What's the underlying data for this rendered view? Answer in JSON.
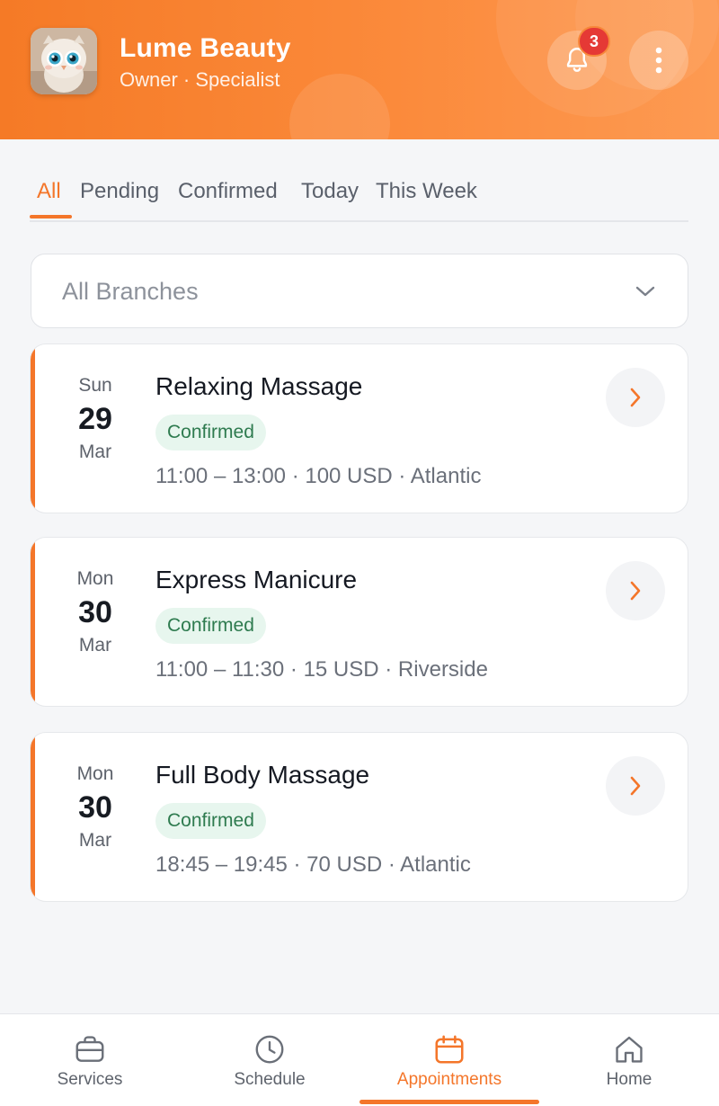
{
  "header": {
    "title": "Lume Beauty",
    "subtitle": "Owner · Specialist",
    "notification_count": "3"
  },
  "tabs": [
    {
      "label": "All",
      "active": true
    },
    {
      "label": "Pending",
      "active": false
    },
    {
      "label": "Confirmed",
      "active": false
    },
    {
      "label": "Today",
      "active": false
    },
    {
      "label": "This Week",
      "active": false
    }
  ],
  "branch_filter": {
    "selected": "All Branches"
  },
  "appointments": [
    {
      "dow": "Sun",
      "day": "29",
      "month": "Mar",
      "service": "Relaxing Massage",
      "status": "Confirmed",
      "details": "11:00 – 13:00 · 100 USD · Atlantic"
    },
    {
      "dow": "Mon",
      "day": "30",
      "month": "Mar",
      "service": "Express Manicure",
      "status": "Confirmed",
      "details": "11:00 – 11:30 · 15 USD · Riverside"
    },
    {
      "dow": "Mon",
      "day": "30",
      "month": "Mar",
      "service": "Full Body Massage",
      "status": "Confirmed",
      "details": "18:45 – 19:45 · 70 USD · Atlantic"
    }
  ],
  "bottom_nav": [
    {
      "label": "Services",
      "icon": "briefcase-icon",
      "active": false
    },
    {
      "label": "Schedule",
      "icon": "clock-icon",
      "active": false
    },
    {
      "label": "Appointments",
      "icon": "calendar-icon",
      "active": true
    },
    {
      "label": "Home",
      "icon": "home-icon",
      "active": false
    }
  ],
  "colors": {
    "accent": "#f4762a",
    "header_start": "#f57a26",
    "header_end": "#fd9a52",
    "status_confirmed_bg": "#e7f6ee",
    "status_confirmed_text": "#2e7b4f",
    "badge": "#e53935"
  }
}
